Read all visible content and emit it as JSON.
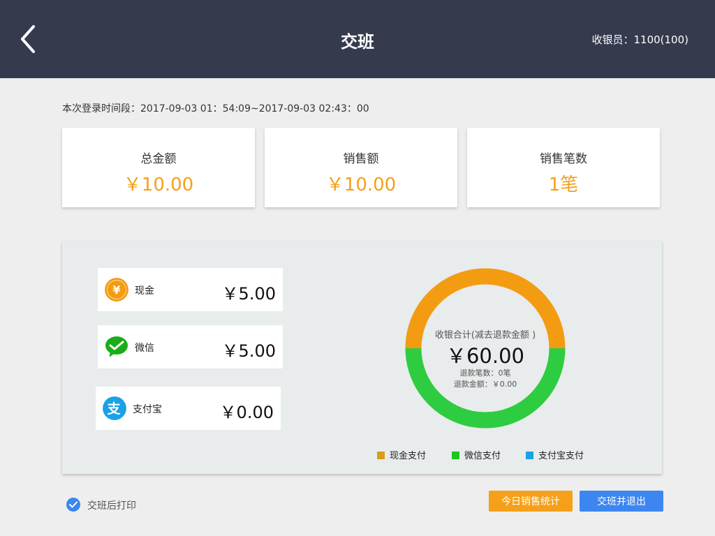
{
  "header": {
    "title": "交班",
    "cashier": "收银员：1100(100)"
  },
  "login_period": "本次登录时间段：2017-09-03 01：54:09~2017-09-03 02:43：00",
  "stats": [
    {
      "label": "总金额",
      "value": "￥10.00"
    },
    {
      "label": "销售额",
      "value": "￥10.00"
    },
    {
      "label": "销售笔数",
      "value": "1笔"
    }
  ],
  "payments": [
    {
      "name": "现金",
      "amount": "￥5.00",
      "icon": "yuan-coin-icon",
      "color": "#f39c12"
    },
    {
      "name": "微信",
      "amount": "￥5.00",
      "icon": "wechat-icon",
      "color": "#1aad19"
    },
    {
      "name": "支付宝",
      "amount": "￥0.00",
      "icon": "alipay-icon",
      "color": "#1aa1e6"
    }
  ],
  "summary": {
    "title": "收银合计(减去退款金额 )",
    "total": "￥60.00",
    "refund_count": "退款笔数：0笔",
    "refund_amount": "退款金额：￥0.00"
  },
  "chart_data": {
    "type": "pie",
    "categories": [
      "现金支付",
      "微信支付",
      "支付宝支付"
    ],
    "values": [
      5,
      5,
      0
    ],
    "colors": [
      "#f39c12",
      "#2ecc40",
      "#1aa1e6"
    ],
    "legend_colors": [
      "#d4a017",
      "#1ec51e",
      "#1aa1e6"
    ],
    "legend_position": "bottom"
  },
  "footer": {
    "print_label": "交班后打印",
    "print_checked": true,
    "stats_button": "今日销售统计",
    "exit_button": "交班并退出"
  },
  "colors": {
    "header_bg": "#353a4d",
    "accent_orange": "#f5a01a",
    "accent_blue": "#3d86f0"
  }
}
